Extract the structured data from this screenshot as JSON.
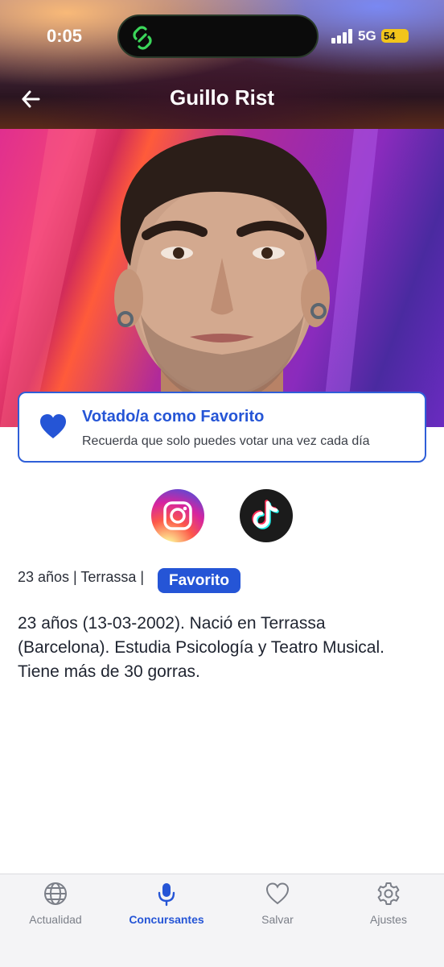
{
  "status_bar": {
    "time": "0:05",
    "network": "5G",
    "battery": "54"
  },
  "nav": {
    "title": "Guillo Rist",
    "back_icon": "arrow-left-icon"
  },
  "favorite_card": {
    "title": "Votado/a como Favorito",
    "subtitle": "Recuerda que solo puedes votar una vez cada día",
    "icon": "heart-filled-icon",
    "accent": "#2555d6"
  },
  "social": [
    {
      "name": "instagram-icon"
    },
    {
      "name": "tiktok-icon"
    }
  ],
  "meta": {
    "info": "23 años | Terrassa |",
    "badge": "Favorito"
  },
  "bio": "23 años (13-03-2002). Nació en Terrassa (Barcelona). Estudia Psicología y Teatro Musical. Tiene más de 30 gorras.",
  "tabs": [
    {
      "label": "Actualidad",
      "icon": "globe-icon",
      "active": false
    },
    {
      "label": "Concursantes",
      "icon": "microphone-icon",
      "active": true
    },
    {
      "label": "Salvar",
      "icon": "heart-outline-icon",
      "active": false
    },
    {
      "label": "Ajustes",
      "icon": "gear-icon",
      "active": false
    }
  ],
  "colors": {
    "accent": "#2555d6",
    "tab_inactive": "#7b7f88"
  }
}
